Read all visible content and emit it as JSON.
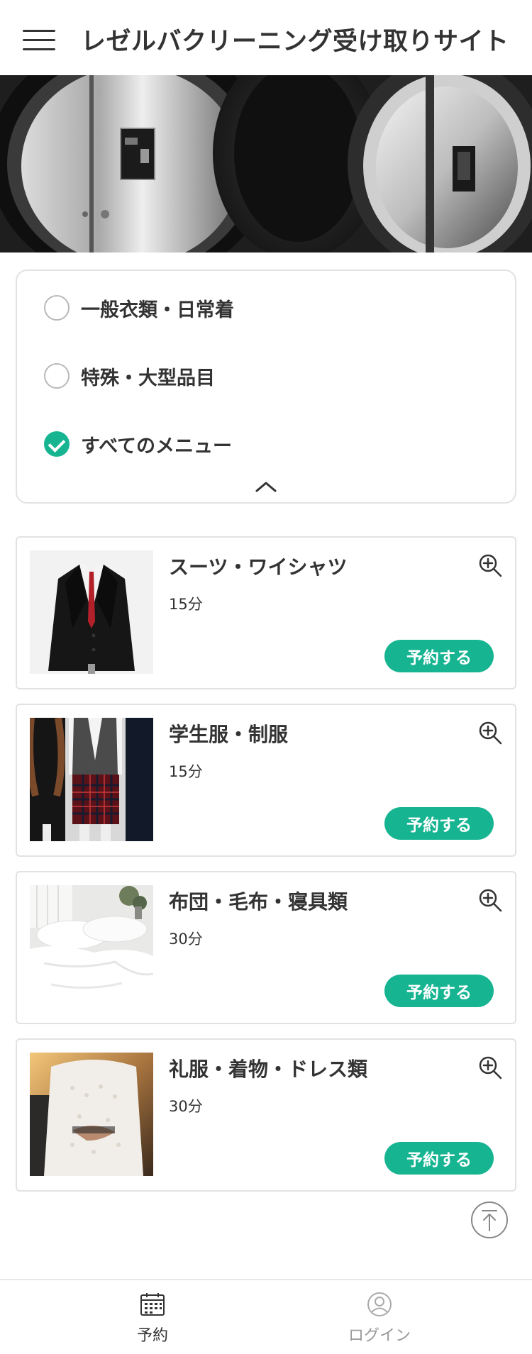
{
  "header": {
    "title": "レゼルバクリーニング受け取りサイト",
    "menu_icon": "hamburger-menu-icon"
  },
  "hero": {
    "image": "washing-machine-doors-photo"
  },
  "filters": {
    "options": [
      {
        "label": "一般衣類・日常着",
        "checked": false
      },
      {
        "label": "特殊・大型品目",
        "checked": false
      },
      {
        "label": "すべてのメニュー",
        "checked": true
      }
    ],
    "collapse_icon": "chevron-up-icon"
  },
  "services": [
    {
      "name": "スーツ・ワイシャツ",
      "duration": "15分",
      "button": "予約する",
      "image": "suit-jacket-photo"
    },
    {
      "name": "学生服・制服",
      "duration": "15分",
      "button": "予約する",
      "image": "school-uniform-photo"
    },
    {
      "name": "布団・毛布・寝具類",
      "duration": "30分",
      "button": "予約する",
      "image": "bedding-photo"
    },
    {
      "name": "礼服・着物・ドレス類",
      "duration": "30分",
      "button": "予約する",
      "image": "dress-photo"
    }
  ],
  "bottom_nav": {
    "items": [
      {
        "label": "予約",
        "icon": "calendar-icon",
        "active": true
      },
      {
        "label": "ログイン",
        "icon": "user-icon",
        "active": false
      }
    ]
  },
  "colors": {
    "accent": "#17b492",
    "text": "#333333",
    "border": "#e2e2e2",
    "inactive": "#999999"
  }
}
